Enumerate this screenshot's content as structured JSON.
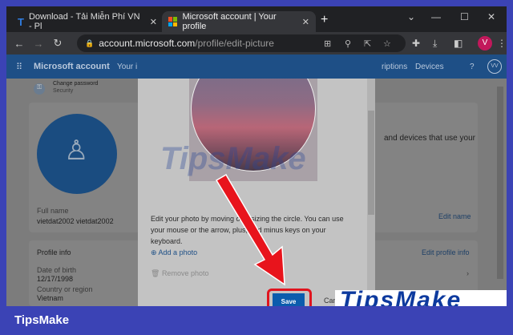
{
  "tabs": [
    {
      "label": "Download - Tải Miễn Phí VN - Pl",
      "close": "✕"
    },
    {
      "label": "Microsoft account | Your profile",
      "close": "✕"
    }
  ],
  "new_tab": "+",
  "window_controls": {
    "minimize": "—",
    "maximize": "☐",
    "close": "✕",
    "tabs_list": "⌄"
  },
  "address": {
    "domain": "account.microsoft.com",
    "path": "/profile/edit-picture"
  },
  "profile_initial": "V",
  "ms_nav": {
    "brand": "Microsoft account",
    "your_info": "Your i",
    "subscriptions": "riptions",
    "devices": "Devices",
    "help": "?",
    "avatar": "VV"
  },
  "security": {
    "title": "Change password",
    "subtitle": "Security"
  },
  "profile": {
    "full_name_label": "Full name",
    "full_name": "vietdat2002 vietdat2002",
    "edit_name": "Edit name",
    "devices_text": "and devices that use your"
  },
  "profile_info": {
    "title": "Profile info",
    "edit": "Edit profile info",
    "dob_label": "Date of birth",
    "dob": "12/17/1998",
    "country_label": "Country or region",
    "country": "Vietnam"
  },
  "modal": {
    "instructions": "Edit your photo by moving or resizing the circle. You can use your mouse or the arrow, plus, and minus keys on your keyboard.",
    "add_photo": "Add a photo",
    "remove_photo": "Remove photo",
    "save": "Save",
    "cancel": "Cancel"
  },
  "watermark": "TipsMake.com",
  "footer_brand": "TipsMake",
  "colors": {
    "frame": "#3b43b5",
    "highlight": "#e0141e",
    "save": "#0b5cad"
  }
}
